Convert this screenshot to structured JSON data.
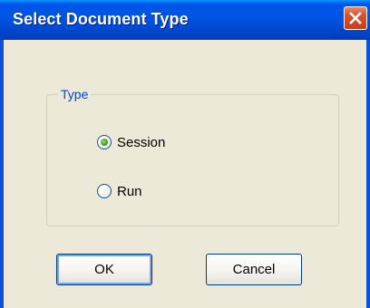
{
  "dialog": {
    "title": "Select Document Type",
    "close_icon": "close-icon"
  },
  "group": {
    "legend": "Type",
    "options": [
      {
        "label": "Session",
        "selected": true
      },
      {
        "label": "Run",
        "selected": false
      }
    ]
  },
  "buttons": {
    "ok": "OK",
    "cancel": "Cancel"
  },
  "colors": {
    "titlebar": "#0054E3",
    "window_bg": "#ECE9D8",
    "legend_text": "#0046D5",
    "close_button": "#D8532D",
    "radio_dot": "#2FA11F"
  }
}
